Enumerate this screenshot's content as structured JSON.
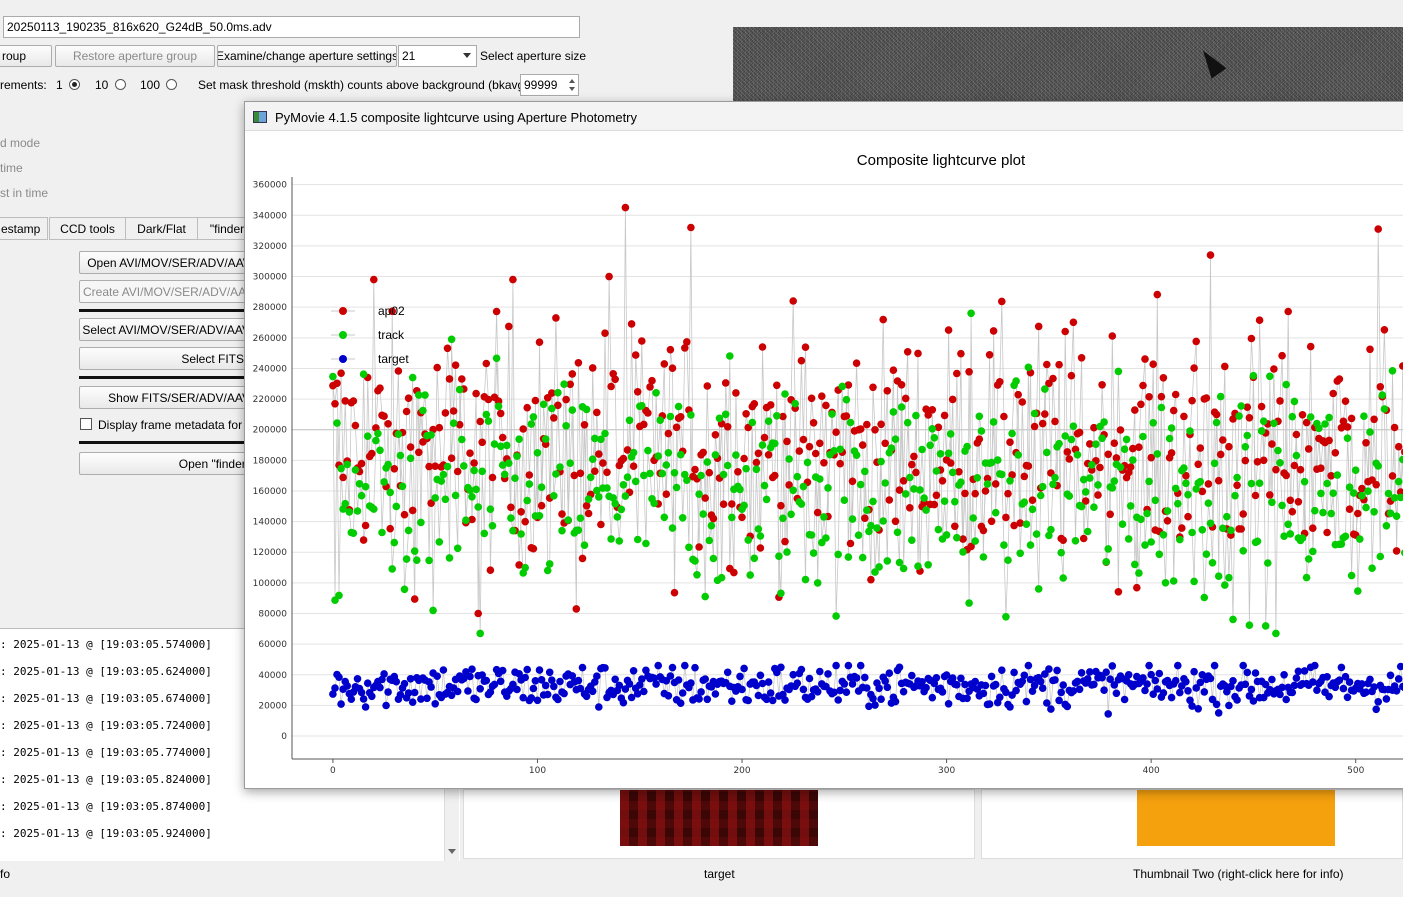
{
  "main": {
    "filename": "20250113_190235_816x620_G24dB_50.0ms.adv",
    "group_button": "roup",
    "restore_button": "Restore aperture group",
    "examine_button": "Examine/change aperture settings",
    "aperture_size_value": "21",
    "aperture_size_label": "Select aperture size",
    "increments_label": "rements:",
    "radio_1": "1",
    "radio_10": "10",
    "radio_100": "100",
    "mask_label": "Set mask threshold (mskth) counts above background (bkavg)",
    "mask_value": "99999",
    "mode_label": "d mode",
    "time_label": " time",
    "time2_label": "st in time",
    "tabs": [
      "estamp",
      "CCD tools",
      "Dark/Flat",
      "\"finder"
    ],
    "btn_open": "Open AVI/MOV/SER/ADV/AAV",
    "btn_create": "Create AVI/MOV/SER/ADV/AAV",
    "btn_select": "Select AVI/MOV/SER/ADV/AAV",
    "btn_select_fits": "Select FITS",
    "btn_show": "Show FITS/SER/ADV/AAV",
    "chk_metadata": "Display frame metadata for A",
    "btn_open_finder": "Open \"finder\"",
    "log_lines": [
      ": 2025-01-13 @ [19:03:05.574000]",
      ": 2025-01-13 @ [19:03:05.624000]",
      ": 2025-01-13 @ [19:03:05.674000]",
      ": 2025-01-13 @ [19:03:05.724000]",
      ": 2025-01-13 @ [19:03:05.774000]",
      ": 2025-01-13 @ [19:03:05.824000]",
      ": 2025-01-13 @ [19:03:05.874000]",
      ": 2025-01-13 @ [19:03:05.924000]"
    ],
    "info_label": "fo",
    "target_label": "target",
    "thumb_two_label": "Thumbnail Two (right-click here for info)"
  },
  "plot_window": {
    "title": "PyMovie 4.1.5 composite lightcurve using Aperture Photometry",
    "icon": "app-window-icon"
  },
  "chart_data": {
    "type": "scatter",
    "title": "Composite lightcurve plot",
    "xlabel": "",
    "ylabel": "",
    "xlim": [
      -20,
      528
    ],
    "ylim": [
      -15000,
      365000
    ],
    "x_ticks": [
      "0",
      "100",
      "200",
      "300",
      "400",
      "500"
    ],
    "y_ticks": [
      "0",
      "20000",
      "40000",
      "60000",
      "80000",
      "100000",
      "120000",
      "140000",
      "160000",
      "180000",
      "200000",
      "220000",
      "240000",
      "260000",
      "280000",
      "300000",
      "320000",
      "340000",
      "360000"
    ],
    "grid": true,
    "legend_position": "top-left",
    "legend": [
      "ap02",
      "track",
      "target"
    ],
    "colors": {
      "ap02": "#cc0000",
      "track": "#00cc00",
      "target": "#0000cc",
      "line": "#c8c8c8"
    },
    "series": [
      {
        "name": "ap02",
        "approx_mean": 190000,
        "approx_min": 80000,
        "approx_max": 345000,
        "highlights": [
          [
            143,
            345000
          ],
          [
            175,
            332000
          ],
          [
            135,
            300000
          ],
          [
            429,
            314000
          ],
          [
            511,
            331000
          ],
          [
            20,
            298000
          ],
          [
            88,
            298000
          ],
          [
            71,
            80000
          ],
          [
            119,
            83000
          ]
        ]
      },
      {
        "name": "track",
        "approx_mean": 160000,
        "approx_min": 67000,
        "approx_max": 276000,
        "highlights": [
          [
            72,
            67000
          ],
          [
            461,
            67000
          ],
          [
            312,
            276000
          ],
          [
            49,
            82000
          ],
          [
            58,
            259000
          ]
        ]
      },
      {
        "name": "target",
        "approx_mean": 33000,
        "approx_min": 13000,
        "approx_max": 46000
      }
    ],
    "n_points": 530
  }
}
